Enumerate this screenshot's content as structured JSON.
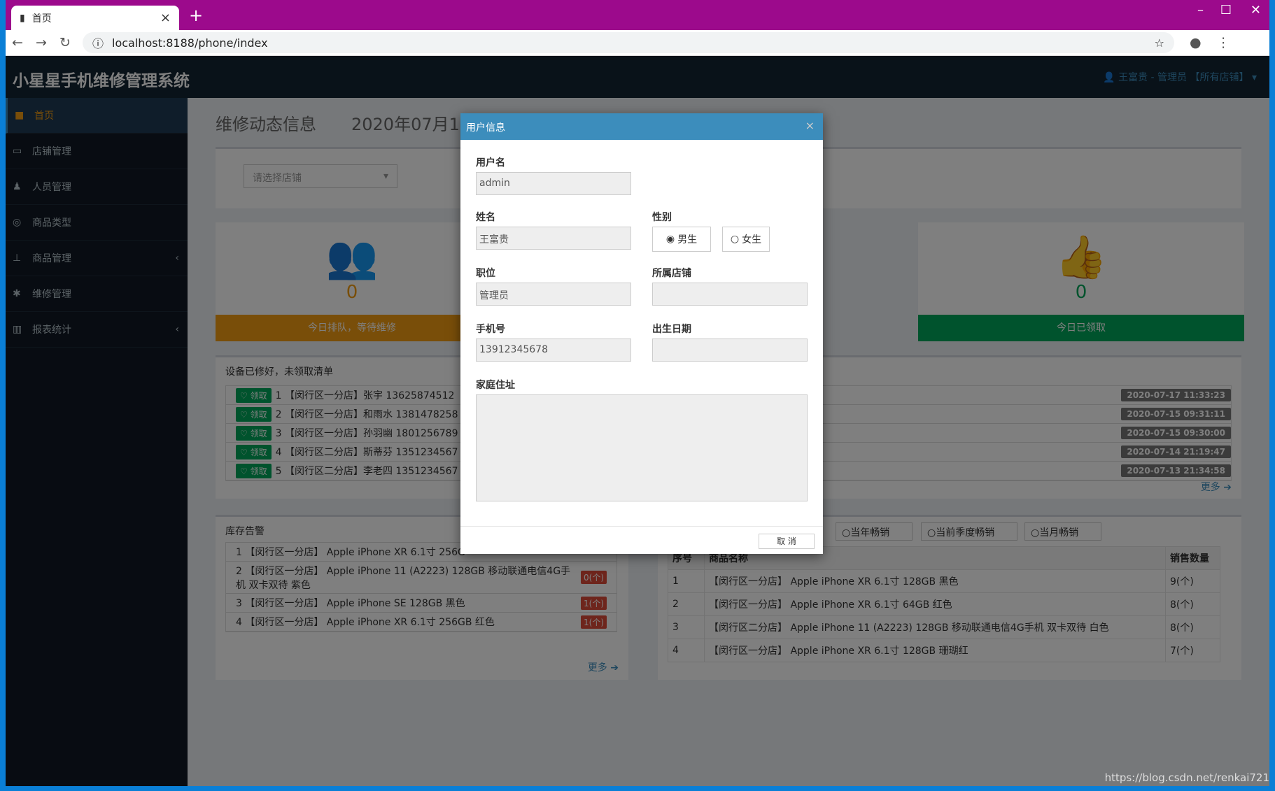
{
  "browser": {
    "tab_title": "首页",
    "url": "localhost:8188/phone/index"
  },
  "app": {
    "brand": "小星星手机维修管理系统",
    "user": "王富贵 - 管理员 【所有店铺】"
  },
  "sidebar": {
    "items": [
      {
        "label": "首页",
        "icon": "home-icon"
      },
      {
        "label": "店铺管理",
        "icon": "desktop-icon"
      },
      {
        "label": "人员管理",
        "icon": "users-icon"
      },
      {
        "label": "商品类型",
        "icon": "circle-icon"
      },
      {
        "label": "商品管理",
        "icon": "sitemap-icon"
      },
      {
        "label": "维修管理",
        "icon": "bug-icon"
      },
      {
        "label": "报表统计",
        "icon": "bar-chart-icon"
      }
    ]
  },
  "page": {
    "title": "维修动态信息",
    "date": "2020年07月1",
    "shop_select_placeholder": "请选择店铺"
  },
  "cards": [
    {
      "num": "0",
      "label": "今日排队，等待维修",
      "color": "#f39c12"
    },
    {
      "num": "0",
      "label": "今日已领取",
      "color": "#00a65a"
    }
  ],
  "repaired": {
    "title": "设备已修好，未领取清单",
    "claim": "领取",
    "rows": [
      {
        "text": "1 【闵行区一分店】张宇 13625874512",
        "time": "2020-07-17 11:33:23"
      },
      {
        "text": "2 【闵行区一分店】和雨水 1381478258",
        "time": "2020-07-15 09:31:11"
      },
      {
        "text": "3 【闵行区一分店】孙羽幽 1801256789",
        "time": "2020-07-15 09:30:00"
      },
      {
        "text": "4 【闵行区二分店】斯蒂芬 1351234567",
        "time": "2020-07-14 21:19:47"
      },
      {
        "text": "5 【闵行区二分店】李老四 1351234567",
        "time": "2020-07-13 21:34:58"
      }
    ],
    "more": "更多"
  },
  "stock": {
    "title": "库存告警",
    "rows": [
      {
        "text": "1 【闵行区一分店】 Apple iPhone XR 6.1寸 256G",
        "badge": ""
      },
      {
        "text": "2 【闵行区一分店】 Apple iPhone 11 (A2223) 128GB 移动联通电信4G手机 双卡双待 紫色",
        "badge": "0(个)"
      },
      {
        "text": "3 【闵行区一分店】 Apple iPhone SE 128GB 黑色",
        "badge": "1(个)"
      },
      {
        "text": "4 【闵行区一分店】 Apple iPhone XR 6.1寸 256GB 红色",
        "badge": "1(个)"
      }
    ],
    "more": "更多"
  },
  "sales": {
    "filters": [
      "当年畅销",
      "当前季度畅销",
      "当月畅销"
    ],
    "headers": [
      "序号",
      "商品名称",
      "销售数量"
    ],
    "rows": [
      [
        "1",
        "【闵行区一分店】 Apple iPhone XR 6.1寸 128GB 黑色",
        "9(个)"
      ],
      [
        "2",
        "【闵行区一分店】 Apple iPhone XR 6.1寸 64GB 红色",
        "8(个)"
      ],
      [
        "3",
        "【闵行区二分店】 Apple iPhone 11 (A2223) 128GB 移动联通电信4G手机 双卡双待 白色",
        "8(个)"
      ],
      [
        "4",
        "【闵行区一分店】 Apple iPhone XR 6.1寸 128GB 珊瑚红",
        "7(个)"
      ]
    ]
  },
  "modal": {
    "title": "用户信息",
    "username_label": "用户名",
    "username": "admin",
    "name_label": "姓名",
    "name": "王富贵",
    "gender_label": "性别",
    "male": "男生",
    "female": "女生",
    "position_label": "职位",
    "position": "管理员",
    "shop_label": "所属店铺",
    "shop": "",
    "phone_label": "手机号",
    "phone": "13912345678",
    "birth_label": "出生日期",
    "birth": "",
    "address_label": "家庭住址",
    "address": "",
    "cancel": "取 消"
  },
  "watermark": "https://blog.csdn.net/renkai721"
}
